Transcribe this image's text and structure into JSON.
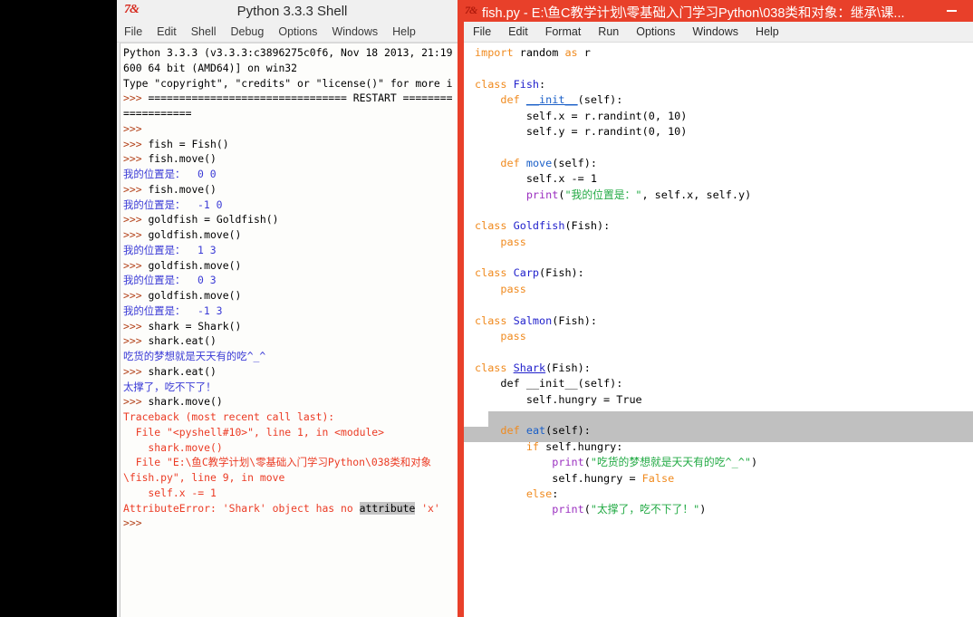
{
  "shell": {
    "logo": "7&",
    "title": "Python 3.3.3 Shell",
    "menu": [
      "File",
      "Edit",
      "Shell",
      "Debug",
      "Options",
      "Windows",
      "Help"
    ],
    "lines": [
      {
        "parts": [
          {
            "t": "Python 3.3.3 (v3.3.3:c3896275c0f6, Nov 18 2013, 21:19",
            "c": "black"
          }
        ]
      },
      {
        "parts": [
          {
            "t": "600 64 bit (AMD64)] on win32",
            "c": "black"
          }
        ]
      },
      {
        "parts": [
          {
            "t": "Type \"copyright\", \"credits\" or \"license()\" for more i",
            "c": "black"
          }
        ]
      },
      {
        "parts": [
          {
            "t": ">>> ",
            "c": "prompt"
          },
          {
            "t": "================================ RESTART ========",
            "c": "black"
          }
        ]
      },
      {
        "parts": [
          {
            "t": "===========",
            "c": "black"
          }
        ]
      },
      {
        "parts": [
          {
            "t": ">>> ",
            "c": "prompt"
          }
        ]
      },
      {
        "parts": [
          {
            "t": ">>> ",
            "c": "prompt"
          },
          {
            "t": "fish = Fish()",
            "c": "black"
          }
        ]
      },
      {
        "parts": [
          {
            "t": ">>> ",
            "c": "prompt"
          },
          {
            "t": "fish.move()",
            "c": "black"
          }
        ]
      },
      {
        "parts": [
          {
            "t": "我的位置是：  0 0",
            "c": "blue"
          }
        ]
      },
      {
        "parts": [
          {
            "t": ">>> ",
            "c": "prompt"
          },
          {
            "t": "fish.move()",
            "c": "black"
          }
        ]
      },
      {
        "parts": [
          {
            "t": "我的位置是：  -1 0",
            "c": "blue"
          }
        ]
      },
      {
        "parts": [
          {
            "t": ">>> ",
            "c": "prompt"
          },
          {
            "t": "goldfish = Goldfish()",
            "c": "black"
          }
        ]
      },
      {
        "parts": [
          {
            "t": ">>> ",
            "c": "prompt"
          },
          {
            "t": "goldfish.move()",
            "c": "black"
          }
        ]
      },
      {
        "parts": [
          {
            "t": "我的位置是：  1 3",
            "c": "blue"
          }
        ]
      },
      {
        "parts": [
          {
            "t": ">>> ",
            "c": "prompt"
          },
          {
            "t": "goldfish.move()",
            "c": "black"
          }
        ]
      },
      {
        "parts": [
          {
            "t": "我的位置是：  0 3",
            "c": "blue"
          }
        ]
      },
      {
        "parts": [
          {
            "t": ">>> ",
            "c": "prompt"
          },
          {
            "t": "goldfish.move()",
            "c": "black"
          }
        ]
      },
      {
        "parts": [
          {
            "t": "我的位置是：  -1 3",
            "c": "blue"
          }
        ]
      },
      {
        "parts": [
          {
            "t": ">>> ",
            "c": "prompt"
          },
          {
            "t": "shark = Shark()",
            "c": "black"
          }
        ]
      },
      {
        "parts": [
          {
            "t": ">>> ",
            "c": "prompt"
          },
          {
            "t": "shark.eat()",
            "c": "black"
          }
        ]
      },
      {
        "parts": [
          {
            "t": "吃货的梦想就是天天有的吃^_^",
            "c": "blue"
          }
        ]
      },
      {
        "parts": [
          {
            "t": ">>> ",
            "c": "prompt"
          },
          {
            "t": "shark.eat()",
            "c": "black"
          }
        ]
      },
      {
        "parts": [
          {
            "t": "太撑了，吃不下了！",
            "c": "blue"
          }
        ]
      },
      {
        "parts": [
          {
            "t": ">>> ",
            "c": "prompt"
          },
          {
            "t": "shark.move()",
            "c": "black"
          }
        ]
      },
      {
        "parts": [
          {
            "t": "Traceback (most recent call last):",
            "c": "red"
          }
        ]
      },
      {
        "parts": [
          {
            "t": "  File \"<pyshell#10>\", line 1, in <module>",
            "c": "red"
          }
        ]
      },
      {
        "parts": [
          {
            "t": "    shark.move()",
            "c": "red"
          }
        ]
      },
      {
        "parts": [
          {
            "t": "  File \"E:\\鱼C教学计划\\零基础入门学习Python\\038类和对象",
            "c": "red"
          }
        ]
      },
      {
        "parts": [
          {
            "t": "\\fish.py\", line 9, in move",
            "c": "red"
          }
        ]
      },
      {
        "parts": [
          {
            "t": "    self.x -= 1",
            "c": "red"
          }
        ]
      },
      {
        "parts": [
          {
            "t": "AttributeError: 'Shark' object has no ",
            "c": "red"
          },
          {
            "t": "attribute",
            "c": "sel"
          },
          {
            "t": " 'x'",
            "c": "red"
          }
        ]
      },
      {
        "parts": [
          {
            "t": ">>> ",
            "c": "prompt"
          }
        ]
      }
    ]
  },
  "editor": {
    "logo": "7&",
    "title": "fish.py - E:\\鱼C教学计划\\零基础入门学习Python\\038类和对象：继承\\课...",
    "minimize_label": "minimize",
    "menu": [
      "File",
      "Edit",
      "Format",
      "Run",
      "Options",
      "Windows",
      "Help"
    ],
    "cursor_word": "True",
    "code_lines": [
      {
        "parts": [
          {
            "t": "import",
            "c": "kw"
          },
          {
            "t": " random ",
            "c": "plain"
          },
          {
            "t": "as",
            "c": "kw"
          },
          {
            "t": " r",
            "c": "plain"
          }
        ]
      },
      {
        "parts": []
      },
      {
        "parts": [
          {
            "t": "class",
            "c": "kw"
          },
          {
            "t": " ",
            "c": "plain"
          },
          {
            "t": "Fish",
            "c": "cls"
          },
          {
            "t": ":",
            "c": "plain"
          }
        ]
      },
      {
        "parts": [
          {
            "t": "    ",
            "c": "plain"
          },
          {
            "t": "def",
            "c": "kw"
          },
          {
            "t": " ",
            "c": "plain"
          },
          {
            "t": "__init__",
            "c": "defu"
          },
          {
            "t": "(self):",
            "c": "plain"
          }
        ]
      },
      {
        "parts": [
          {
            "t": "        self.x = r.randint(0, 10)",
            "c": "plain"
          }
        ]
      },
      {
        "parts": [
          {
            "t": "        self.y = r.randint(0, 10)",
            "c": "plain"
          }
        ]
      },
      {
        "parts": []
      },
      {
        "parts": [
          {
            "t": "    ",
            "c": "plain"
          },
          {
            "t": "def",
            "c": "kw"
          },
          {
            "t": " ",
            "c": "plain"
          },
          {
            "t": "move",
            "c": "def"
          },
          {
            "t": "(self):",
            "c": "plain"
          }
        ]
      },
      {
        "parts": [
          {
            "t": "        self.x -= 1",
            "c": "plain"
          }
        ]
      },
      {
        "parts": [
          {
            "t": "        ",
            "c": "plain"
          },
          {
            "t": "print",
            "c": "bi"
          },
          {
            "t": "(",
            "c": "plain"
          },
          {
            "t": "\"我的位置是：\"",
            "c": "str"
          },
          {
            "t": ", self.x, self.y)",
            "c": "plain"
          }
        ]
      },
      {
        "parts": []
      },
      {
        "parts": [
          {
            "t": "class",
            "c": "kw"
          },
          {
            "t": " ",
            "c": "plain"
          },
          {
            "t": "Goldfish",
            "c": "cls"
          },
          {
            "t": "(Fish):",
            "c": "plain"
          }
        ]
      },
      {
        "parts": [
          {
            "t": "    ",
            "c": "plain"
          },
          {
            "t": "pass",
            "c": "kw"
          }
        ]
      },
      {
        "parts": []
      },
      {
        "parts": [
          {
            "t": "class",
            "c": "kw"
          },
          {
            "t": " ",
            "c": "plain"
          },
          {
            "t": "Carp",
            "c": "cls"
          },
          {
            "t": "(Fish):",
            "c": "plain"
          }
        ]
      },
      {
        "parts": [
          {
            "t": "    ",
            "c": "plain"
          },
          {
            "t": "pass",
            "c": "kw"
          }
        ]
      },
      {
        "parts": []
      },
      {
        "parts": [
          {
            "t": "class",
            "c": "kw"
          },
          {
            "t": " ",
            "c": "plain"
          },
          {
            "t": "Salmon",
            "c": "cls"
          },
          {
            "t": "(Fish):",
            "c": "plain"
          }
        ]
      },
      {
        "parts": [
          {
            "t": "    ",
            "c": "plain"
          },
          {
            "t": "pass",
            "c": "kw"
          }
        ]
      },
      {
        "parts": []
      },
      {
        "parts": [
          {
            "t": "class",
            "c": "kw"
          },
          {
            "t": " ",
            "c": "plain"
          },
          {
            "t": "Shark",
            "c": "clsdef"
          },
          {
            "t": "(Fish):",
            "c": "plain"
          }
        ]
      },
      {
        "parts": [
          {
            "t": "    ",
            "c": "plain"
          },
          {
            "t": "def",
            "c": "plain"
          },
          {
            "t": " ",
            "c": "plain"
          },
          {
            "t": "__init__",
            "c": "plain"
          },
          {
            "t": "(self):",
            "c": "plain"
          }
        ]
      },
      {
        "parts": [
          {
            "t": "        self.hungry = True",
            "c": "plain"
          }
        ]
      },
      {
        "parts": []
      },
      {
        "parts": [
          {
            "t": "    ",
            "c": "plain"
          },
          {
            "t": "def",
            "c": "kw"
          },
          {
            "t": " ",
            "c": "plain"
          },
          {
            "t": "eat",
            "c": "def"
          },
          {
            "t": "(self):",
            "c": "plain"
          }
        ]
      },
      {
        "parts": [
          {
            "t": "        ",
            "c": "plain"
          },
          {
            "t": "if",
            "c": "kw"
          },
          {
            "t": " self.hungry:",
            "c": "plain"
          }
        ]
      },
      {
        "parts": [
          {
            "t": "            ",
            "c": "plain"
          },
          {
            "t": "print",
            "c": "bi"
          },
          {
            "t": "(",
            "c": "plain"
          },
          {
            "t": "\"吃货的梦想就是天天有的吃^_^\"",
            "c": "str"
          },
          {
            "t": ")",
            "c": "plain"
          }
        ]
      },
      {
        "parts": [
          {
            "t": "            self.hungry = ",
            "c": "plain"
          },
          {
            "t": "False",
            "c": "kwval"
          }
        ]
      },
      {
        "parts": [
          {
            "t": "        ",
            "c": "plain"
          },
          {
            "t": "else",
            "c": "kw"
          },
          {
            "t": ":",
            "c": "plain"
          }
        ]
      },
      {
        "parts": [
          {
            "t": "            ",
            "c": "plain"
          },
          {
            "t": "print",
            "c": "bi"
          },
          {
            "t": "(",
            "c": "plain"
          },
          {
            "t": "\"太撑了，吃不下了！\"",
            "c": "str"
          },
          {
            "t": ")",
            "c": "plain"
          }
        ]
      }
    ]
  },
  "colors": {
    "editor_frame_red": "#e8402a",
    "shell_chrome": "#f0f0f0",
    "prompt_orange": "#b3421a",
    "output_blue": "#3a3ad6",
    "error_red": "#eb3b24",
    "keyword_orange": "#f08a1e",
    "string_green": "#22aa44",
    "builtin_purple": "#9b30c0",
    "classname_blue": "#2222cc",
    "defname_blue": "#1a5fc8",
    "selection_gray": "#c0c0c0"
  }
}
